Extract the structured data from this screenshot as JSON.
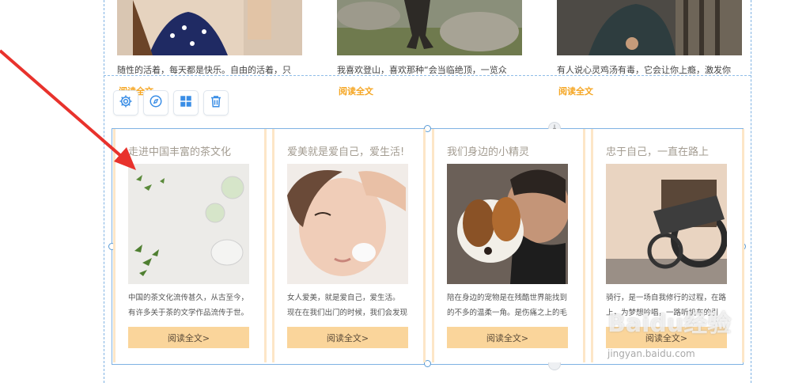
{
  "top_cards": [
    {
      "text": "随性的活着，每天都是快乐。自由的活着，只",
      "link": "阅读全文"
    },
    {
      "text": "我喜欢登山，喜欢那种“会当临绝顶，一览众",
      "link": "阅读全文"
    },
    {
      "text": "有人说心灵鸡汤有毒，它会让你上瘾，激发你",
      "link": "阅读全文"
    }
  ],
  "toolbar": {
    "icons": [
      "gear-icon",
      "compass-icon",
      "grid-icon",
      "trash-icon"
    ]
  },
  "cards": [
    {
      "title": "走进中国丰富的茶文化",
      "line1": "中国的茶文化流传甚久，从古至今，",
      "line2": "有许多关于茶的文学作品流传于世。",
      "button": "阅读全文>"
    },
    {
      "title": "爱美就是爱自己，爱生活!",
      "line1": "女人爱美，就是爱自己，爱生活。",
      "line2": "现在在我们出门的时候，我们会发现",
      "button": "阅读全文>"
    },
    {
      "title": "我们身边的小精灵",
      "line1": "陪在身边的宠物是在残酷世界能找到",
      "line2": "的不多的温柔一角。是伤痛之上的毛",
      "button": "阅读全文>"
    },
    {
      "title": "忠于自己，一直在路上",
      "line1": "骑行，是一场自我修行的过程，在路",
      "line2": "上，为梦想吟唱，一路听机车的引",
      "button": "阅读全文>"
    }
  ],
  "watermark": {
    "logo": "Baidu经验",
    "url": "jingyan.baidu.com"
  },
  "colors": {
    "accent_orange": "#f5a623",
    "button_bg": "#fad59b",
    "card_border": "#fde6c7",
    "selection_blue": "#7fb2e3",
    "toolbar_icon_blue": "#3a8ee6",
    "arrow_red": "#e8322c"
  }
}
